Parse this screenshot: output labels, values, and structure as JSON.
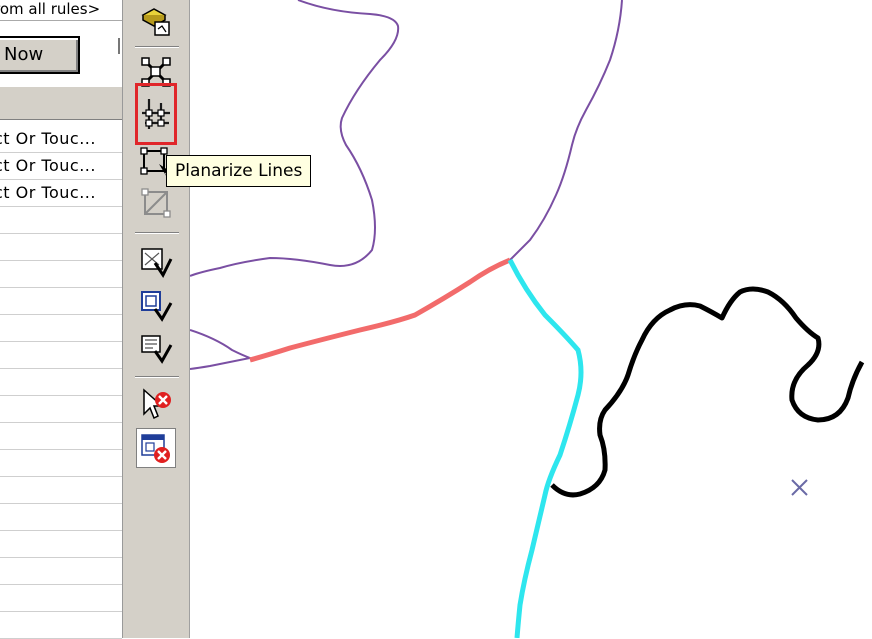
{
  "left_panel": {
    "rule_dropdown_text": "rom all rules>",
    "run_now_label": "Now",
    "rule_rows": [
      "ct Or Touc...",
      "ct Or Touc...",
      "ct Or Touc...",
      "",
      "",
      "",
      "",
      "",
      "",
      "",
      "",
      "",
      "",
      "",
      "",
      "",
      "",
      "",
      ""
    ]
  },
  "toolbar": {
    "buttons": [
      {
        "name": "add-layer-icon"
      },
      {
        "name": "topology-tool-icon"
      },
      {
        "name": "planarize-lines-icon"
      },
      {
        "name": "construct-features-icon"
      },
      {
        "name": "disabled-tool-icon"
      },
      {
        "name": "validate-visible-extent-icon"
      },
      {
        "name": "validate-topology-icon"
      },
      {
        "name": "validate-entire-topology-icon"
      },
      {
        "name": "clear-selection-icon"
      },
      {
        "name": "clear-selected-errors-icon"
      }
    ],
    "tooltip_text": "Planarize Lines"
  },
  "map": {
    "line_colors": {
      "purple": "#7a4fa3",
      "red": "#f26b6b",
      "cyan": "#2ee6ee",
      "black": "#000000",
      "marker": "#6a6aa6"
    },
    "marker_icon": "x-marker-icon"
  }
}
